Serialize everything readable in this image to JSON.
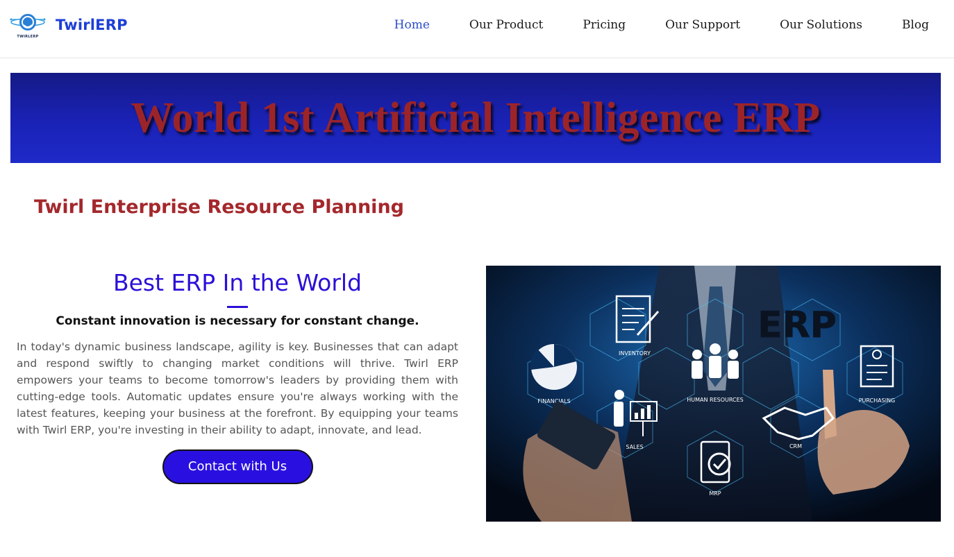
{
  "header": {
    "brand": "TwirlERP",
    "logo_caption": "TWIRLERP",
    "nav": [
      {
        "label": "Home",
        "active": true
      },
      {
        "label": "Our Product",
        "active": false
      },
      {
        "label": "Pricing",
        "active": false
      },
      {
        "label": "Our Support",
        "active": false
      },
      {
        "label": "Our Solutions",
        "active": false
      },
      {
        "label": "Blog",
        "active": false
      }
    ]
  },
  "banner": {
    "text": "World 1st Artificial Intelligence ERP"
  },
  "section": {
    "title": "Twirl Enterprise Resource Planning"
  },
  "content": {
    "heading": "Best ERP In the World",
    "tagline": "Constant innovation is necessary for constant change.",
    "body": "In today's dynamic business landscape, agility is key. Businesses that can adapt and respond swiftly to changing market conditions will thrive. Twirl ERP empowers your teams to become tomorrow's leaders by providing them with cutting-edge tools. Automatic updates ensure you're always working with the latest features, keeping your business at the forefront. By equipping your teams with Twirl ERP, you're investing in their ability to adapt, innovate, and lead.",
    "cta_label": "Contact with Us"
  },
  "hero_image": {
    "title": "ERP",
    "modules": [
      "INVENTORY",
      "FINANCIALS",
      "HUMAN RESOURCES",
      "PURCHASING",
      "SALES",
      "CRM",
      "MRP"
    ]
  },
  "colors": {
    "brand_blue": "#1d3fd6",
    "accent_purple": "#2a10d8",
    "banner_red": "#9c2428",
    "section_red": "#a4282c"
  }
}
